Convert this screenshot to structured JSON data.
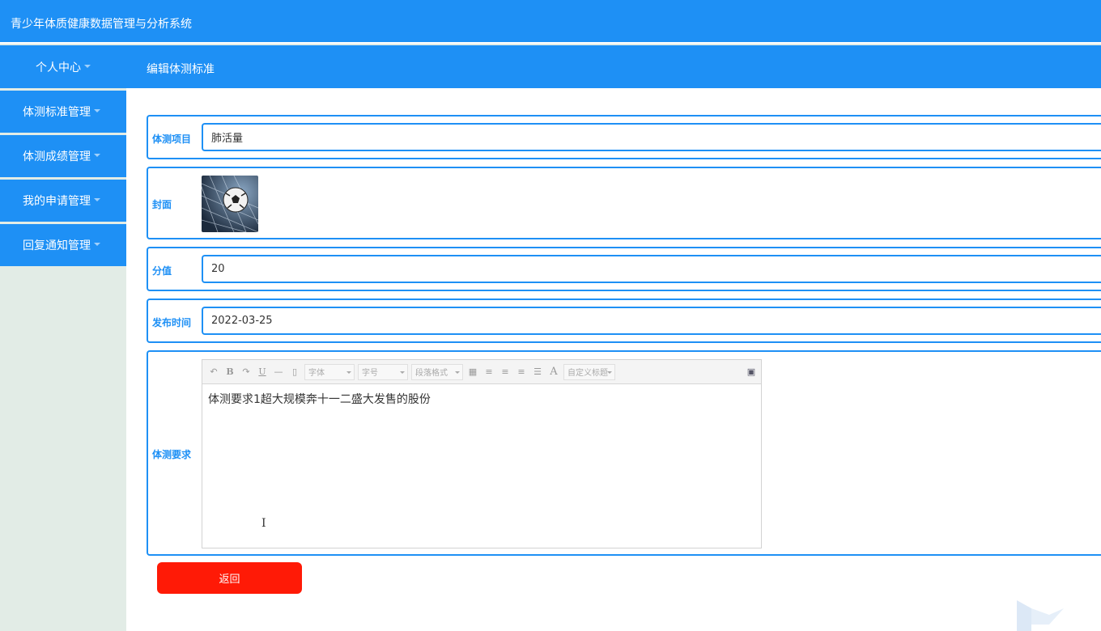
{
  "app": {
    "title": "青少年体质健康数据管理与分析系统"
  },
  "nav": {
    "user_center": "个人中心"
  },
  "breadcrumb": {
    "current": "编辑体测标准"
  },
  "sidebar": {
    "items": [
      {
        "label": "体测标准管理"
      },
      {
        "label": "体测成绩管理"
      },
      {
        "label": "我的申请管理"
      },
      {
        "label": "回复通知管理"
      }
    ]
  },
  "form": {
    "item": {
      "label": "体测项目",
      "value": "肺活量"
    },
    "cover": {
      "label": "封面",
      "image": "soccer-ball-in-net"
    },
    "score": {
      "label": "分值",
      "value": "20"
    },
    "publish_time": {
      "label": "发布时间",
      "value": "2022-03-25"
    },
    "requirements": {
      "label": "体测要求",
      "toolbar": {
        "font": "字体",
        "size": "字号",
        "paragraph": "段落格式",
        "custom_title": "自定义标题",
        "bold": "B",
        "underline": "U",
        "font_color": "A"
      },
      "content": "体测要求1超大规模奔十一二盛大发售的股份"
    }
  },
  "actions": {
    "back_label": "返回"
  },
  "colors": {
    "primary": "#1e90f5",
    "danger": "#ff1a06",
    "sidebar_bg": "#e2ece6"
  }
}
